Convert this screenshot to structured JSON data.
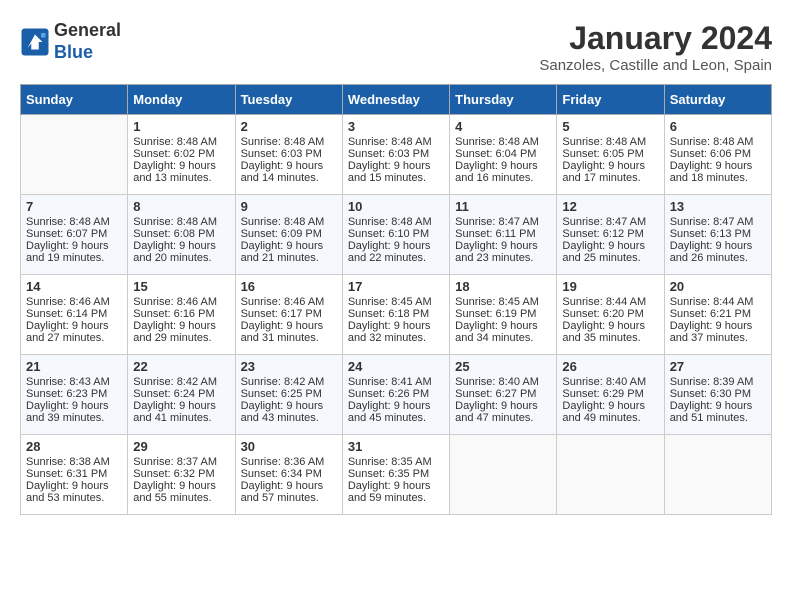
{
  "header": {
    "logo_line1": "General",
    "logo_line2": "Blue",
    "month_title": "January 2024",
    "location": "Sanzoles, Castille and Leon, Spain"
  },
  "days_of_week": [
    "Sunday",
    "Monday",
    "Tuesday",
    "Wednesday",
    "Thursday",
    "Friday",
    "Saturday"
  ],
  "weeks": [
    [
      {
        "day": "",
        "empty": true
      },
      {
        "day": "1",
        "sunrise": "Sunrise: 8:48 AM",
        "sunset": "Sunset: 6:02 PM",
        "daylight": "Daylight: 9 hours and 13 minutes."
      },
      {
        "day": "2",
        "sunrise": "Sunrise: 8:48 AM",
        "sunset": "Sunset: 6:03 PM",
        "daylight": "Daylight: 9 hours and 14 minutes."
      },
      {
        "day": "3",
        "sunrise": "Sunrise: 8:48 AM",
        "sunset": "Sunset: 6:03 PM",
        "daylight": "Daylight: 9 hours and 15 minutes."
      },
      {
        "day": "4",
        "sunrise": "Sunrise: 8:48 AM",
        "sunset": "Sunset: 6:04 PM",
        "daylight": "Daylight: 9 hours and 16 minutes."
      },
      {
        "day": "5",
        "sunrise": "Sunrise: 8:48 AM",
        "sunset": "Sunset: 6:05 PM",
        "daylight": "Daylight: 9 hours and 17 minutes."
      },
      {
        "day": "6",
        "sunrise": "Sunrise: 8:48 AM",
        "sunset": "Sunset: 6:06 PM",
        "daylight": "Daylight: 9 hours and 18 minutes."
      }
    ],
    [
      {
        "day": "7",
        "sunrise": "Sunrise: 8:48 AM",
        "sunset": "Sunset: 6:07 PM",
        "daylight": "Daylight: 9 hours and 19 minutes."
      },
      {
        "day": "8",
        "sunrise": "Sunrise: 8:48 AM",
        "sunset": "Sunset: 6:08 PM",
        "daylight": "Daylight: 9 hours and 20 minutes."
      },
      {
        "day": "9",
        "sunrise": "Sunrise: 8:48 AM",
        "sunset": "Sunset: 6:09 PM",
        "daylight": "Daylight: 9 hours and 21 minutes."
      },
      {
        "day": "10",
        "sunrise": "Sunrise: 8:48 AM",
        "sunset": "Sunset: 6:10 PM",
        "daylight": "Daylight: 9 hours and 22 minutes."
      },
      {
        "day": "11",
        "sunrise": "Sunrise: 8:47 AM",
        "sunset": "Sunset: 6:11 PM",
        "daylight": "Daylight: 9 hours and 23 minutes."
      },
      {
        "day": "12",
        "sunrise": "Sunrise: 8:47 AM",
        "sunset": "Sunset: 6:12 PM",
        "daylight": "Daylight: 9 hours and 25 minutes."
      },
      {
        "day": "13",
        "sunrise": "Sunrise: 8:47 AM",
        "sunset": "Sunset: 6:13 PM",
        "daylight": "Daylight: 9 hours and 26 minutes."
      }
    ],
    [
      {
        "day": "14",
        "sunrise": "Sunrise: 8:46 AM",
        "sunset": "Sunset: 6:14 PM",
        "daylight": "Daylight: 9 hours and 27 minutes."
      },
      {
        "day": "15",
        "sunrise": "Sunrise: 8:46 AM",
        "sunset": "Sunset: 6:16 PM",
        "daylight": "Daylight: 9 hours and 29 minutes."
      },
      {
        "day": "16",
        "sunrise": "Sunrise: 8:46 AM",
        "sunset": "Sunset: 6:17 PM",
        "daylight": "Daylight: 9 hours and 31 minutes."
      },
      {
        "day": "17",
        "sunrise": "Sunrise: 8:45 AM",
        "sunset": "Sunset: 6:18 PM",
        "daylight": "Daylight: 9 hours and 32 minutes."
      },
      {
        "day": "18",
        "sunrise": "Sunrise: 8:45 AM",
        "sunset": "Sunset: 6:19 PM",
        "daylight": "Daylight: 9 hours and 34 minutes."
      },
      {
        "day": "19",
        "sunrise": "Sunrise: 8:44 AM",
        "sunset": "Sunset: 6:20 PM",
        "daylight": "Daylight: 9 hours and 35 minutes."
      },
      {
        "day": "20",
        "sunrise": "Sunrise: 8:44 AM",
        "sunset": "Sunset: 6:21 PM",
        "daylight": "Daylight: 9 hours and 37 minutes."
      }
    ],
    [
      {
        "day": "21",
        "sunrise": "Sunrise: 8:43 AM",
        "sunset": "Sunset: 6:23 PM",
        "daylight": "Daylight: 9 hours and 39 minutes."
      },
      {
        "day": "22",
        "sunrise": "Sunrise: 8:42 AM",
        "sunset": "Sunset: 6:24 PM",
        "daylight": "Daylight: 9 hours and 41 minutes."
      },
      {
        "day": "23",
        "sunrise": "Sunrise: 8:42 AM",
        "sunset": "Sunset: 6:25 PM",
        "daylight": "Daylight: 9 hours and 43 minutes."
      },
      {
        "day": "24",
        "sunrise": "Sunrise: 8:41 AM",
        "sunset": "Sunset: 6:26 PM",
        "daylight": "Daylight: 9 hours and 45 minutes."
      },
      {
        "day": "25",
        "sunrise": "Sunrise: 8:40 AM",
        "sunset": "Sunset: 6:27 PM",
        "daylight": "Daylight: 9 hours and 47 minutes."
      },
      {
        "day": "26",
        "sunrise": "Sunrise: 8:40 AM",
        "sunset": "Sunset: 6:29 PM",
        "daylight": "Daylight: 9 hours and 49 minutes."
      },
      {
        "day": "27",
        "sunrise": "Sunrise: 8:39 AM",
        "sunset": "Sunset: 6:30 PM",
        "daylight": "Daylight: 9 hours and 51 minutes."
      }
    ],
    [
      {
        "day": "28",
        "sunrise": "Sunrise: 8:38 AM",
        "sunset": "Sunset: 6:31 PM",
        "daylight": "Daylight: 9 hours and 53 minutes."
      },
      {
        "day": "29",
        "sunrise": "Sunrise: 8:37 AM",
        "sunset": "Sunset: 6:32 PM",
        "daylight": "Daylight: 9 hours and 55 minutes."
      },
      {
        "day": "30",
        "sunrise": "Sunrise: 8:36 AM",
        "sunset": "Sunset: 6:34 PM",
        "daylight": "Daylight: 9 hours and 57 minutes."
      },
      {
        "day": "31",
        "sunrise": "Sunrise: 8:35 AM",
        "sunset": "Sunset: 6:35 PM",
        "daylight": "Daylight: 9 hours and 59 minutes."
      },
      {
        "day": "",
        "empty": true
      },
      {
        "day": "",
        "empty": true
      },
      {
        "day": "",
        "empty": true
      }
    ]
  ]
}
